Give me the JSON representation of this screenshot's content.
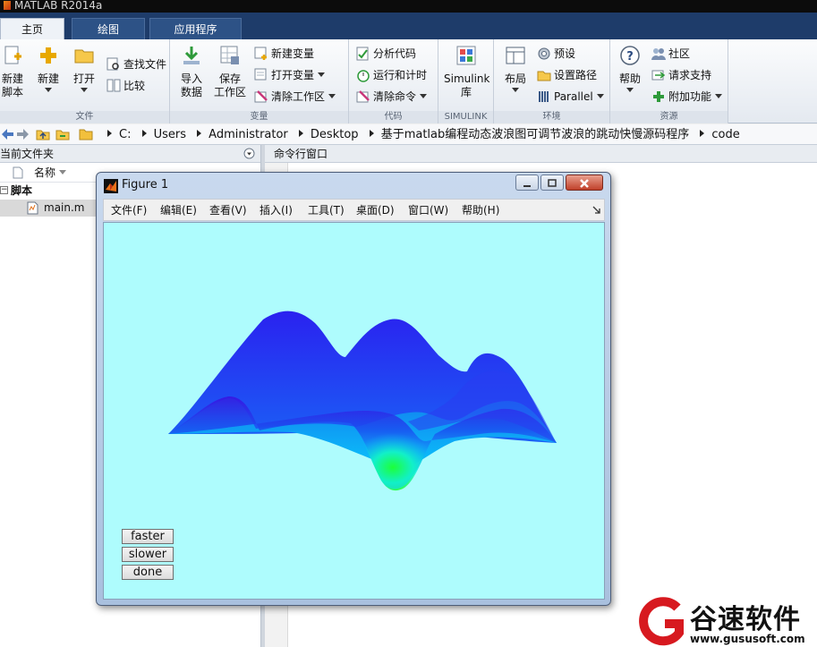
{
  "window_title": "MATLAB R2014a",
  "tabs": [
    "主页",
    "绘图",
    "应用程序"
  ],
  "ribbon": {
    "file": {
      "label": "文件",
      "new_script": [
        "新建",
        "脚本"
      ],
      "new": "新建",
      "open": "打开",
      "find_files": "查找文件",
      "compare": "比较"
    },
    "variable": {
      "label": "变量",
      "import": [
        "导入",
        "数据"
      ],
      "save": [
        "保存",
        "工作区"
      ],
      "new_var": "新建变量",
      "open_var": "打开变量",
      "clear_ws": "清除工作区"
    },
    "code": {
      "label": "代码",
      "analyze": "分析代码",
      "run_time": "运行和计时",
      "clear_cmd": "清除命令"
    },
    "simulink": {
      "label": "SIMULINK",
      "lib": [
        "Simulink",
        "库"
      ]
    },
    "env": {
      "label": "环境",
      "layout": "布局",
      "prefs": "预设",
      "set_path": "设置路径",
      "parallel": "Parallel"
    },
    "resources": {
      "label": "资源",
      "help": "帮助",
      "community": "社区",
      "support": "请求支持",
      "addons": "附加功能"
    }
  },
  "path": [
    "C:",
    "Users",
    "Administrator",
    "Desktop",
    "基于matlab编程动态波浪图可调节波浪的跳动快慢源码程序",
    "code"
  ],
  "left_panel": {
    "title": "当前文件夹",
    "column": "名称",
    "folder": "脚本",
    "file": "main.m"
  },
  "command_window": {
    "title": "命令行窗口"
  },
  "figure": {
    "title": "Figure 1",
    "menu": [
      "文件(F)",
      "编辑(E)",
      "查看(V)",
      "插入(I)",
      "工具(T)",
      "桌面(D)",
      "窗口(W)",
      "帮助(H)"
    ],
    "buttons": [
      "faster",
      "slower",
      "done"
    ],
    "background": "#aefcfd"
  },
  "watermark": {
    "name": "谷速软件",
    "url": "www.gususoft.com"
  },
  "colors": {
    "tab_bar": "#1e3c6a",
    "plot_background": "#aefcfd",
    "surface_high": "#3a10e0",
    "surface_low": "#18ff30",
    "watermark_red": "#d7191f"
  }
}
